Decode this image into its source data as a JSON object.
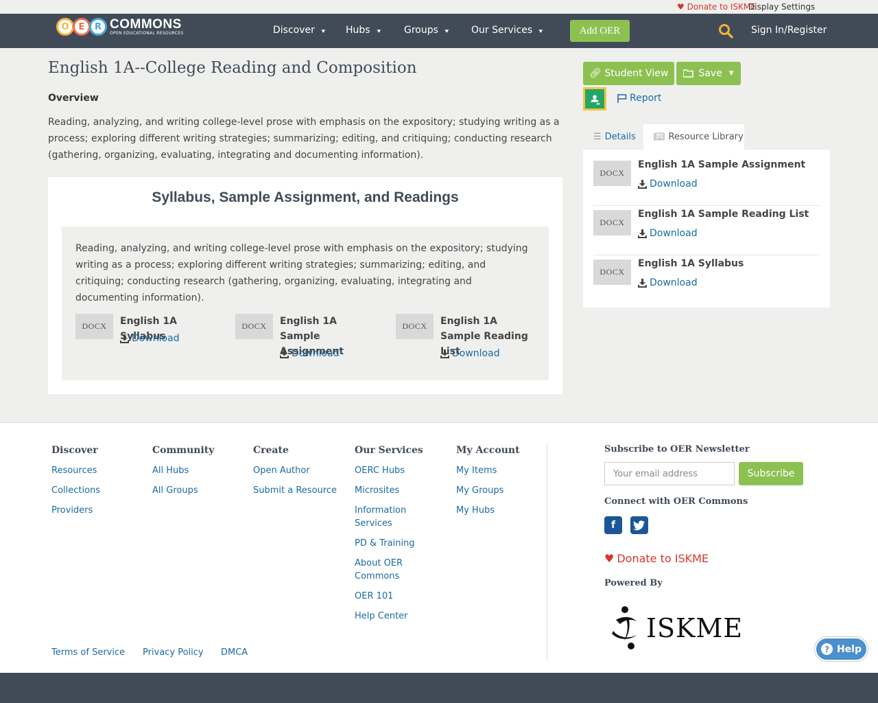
{
  "utility": {
    "donate": "Donate to ISKME",
    "display_settings": "Display Settings"
  },
  "nav": {
    "logo_text": "COMMONS",
    "logo_sub": "OPEN EDUCATIONAL RESOURCES",
    "logo_letters": [
      "O",
      "E",
      "R"
    ],
    "items": [
      "Discover",
      "Hubs",
      "Groups",
      "Our Services"
    ],
    "add_oer": "Add OER",
    "signin": "Sign In/Register"
  },
  "resource": {
    "title": "English 1A--College Reading and Composition",
    "overview_heading": "Overview",
    "overview_text": "Reading, analyzing, and writing college-level prose with emphasis on the expository; studying writing as a process; exploring different writing strategies; summarizing; editing, and critiquing; conducting research (gathering, organizing, evaluating, integrating and documenting information)."
  },
  "section": {
    "title": "Syllabus, Sample Assignment, and Readings",
    "description": "Reading, analyzing, and writing college-level prose with emphasis on the expository; studying writing as a process; exploring different writing strategies; summarizing; editing, and critiquing; conducting research (gathering, organizing, evaluating, integrating and documenting information).",
    "files": [
      {
        "type": "DOCX",
        "title": "English 1A Syllabus",
        "download": "Download"
      },
      {
        "type": "DOCX",
        "title": "English 1A Sample Assignment",
        "download": "Download"
      },
      {
        "type": "DOCX",
        "title": "English 1A Sample Reading List",
        "download": "Download"
      }
    ]
  },
  "sidebar": {
    "student_view": "Student View",
    "save": "Save",
    "report": "Report",
    "tabs": [
      "Details",
      "Resource Library"
    ],
    "library": [
      {
        "type": "DOCX",
        "title": "English 1A Sample Assignment",
        "download": "Download"
      },
      {
        "type": "DOCX",
        "title": "English 1A Sample Reading List",
        "download": "Download"
      },
      {
        "type": "DOCX",
        "title": "English 1A Syllabus",
        "download": "Download"
      }
    ]
  },
  "footer": {
    "columns": [
      {
        "heading": "Discover",
        "links": [
          "Resources",
          "Collections",
          "Providers"
        ]
      },
      {
        "heading": "Community",
        "links": [
          "All Hubs",
          "All Groups"
        ]
      },
      {
        "heading": "Create",
        "links": [
          "Open Author",
          "Submit a Resource"
        ]
      },
      {
        "heading": "Our Services",
        "links": [
          "OERC Hubs",
          "Microsites",
          "Information Services",
          "PD & Training",
          "About OER Commons",
          "OER 101",
          "Help Center"
        ]
      },
      {
        "heading": "My Account",
        "links": [
          "My Items",
          "My Groups",
          "My Hubs"
        ]
      }
    ],
    "newsletter_heading": "Subscribe to OER Newsletter",
    "email_placeholder": "Your email address",
    "subscribe": "Subscribe",
    "connect_heading": "Connect with OER Commons",
    "donate": "Donate to ISKME",
    "powered_by": "Powered By",
    "iskme_logo_text": "ISKME",
    "legal": [
      "Terms of Service",
      "Privacy Policy",
      "DMCA"
    ]
  },
  "help": {
    "label": "Help"
  },
  "colors": {
    "nav_bg": "#414b57",
    "accent_green": "#8cc152",
    "link_blue": "#1a6aa3",
    "donate_red": "#d9352b"
  }
}
